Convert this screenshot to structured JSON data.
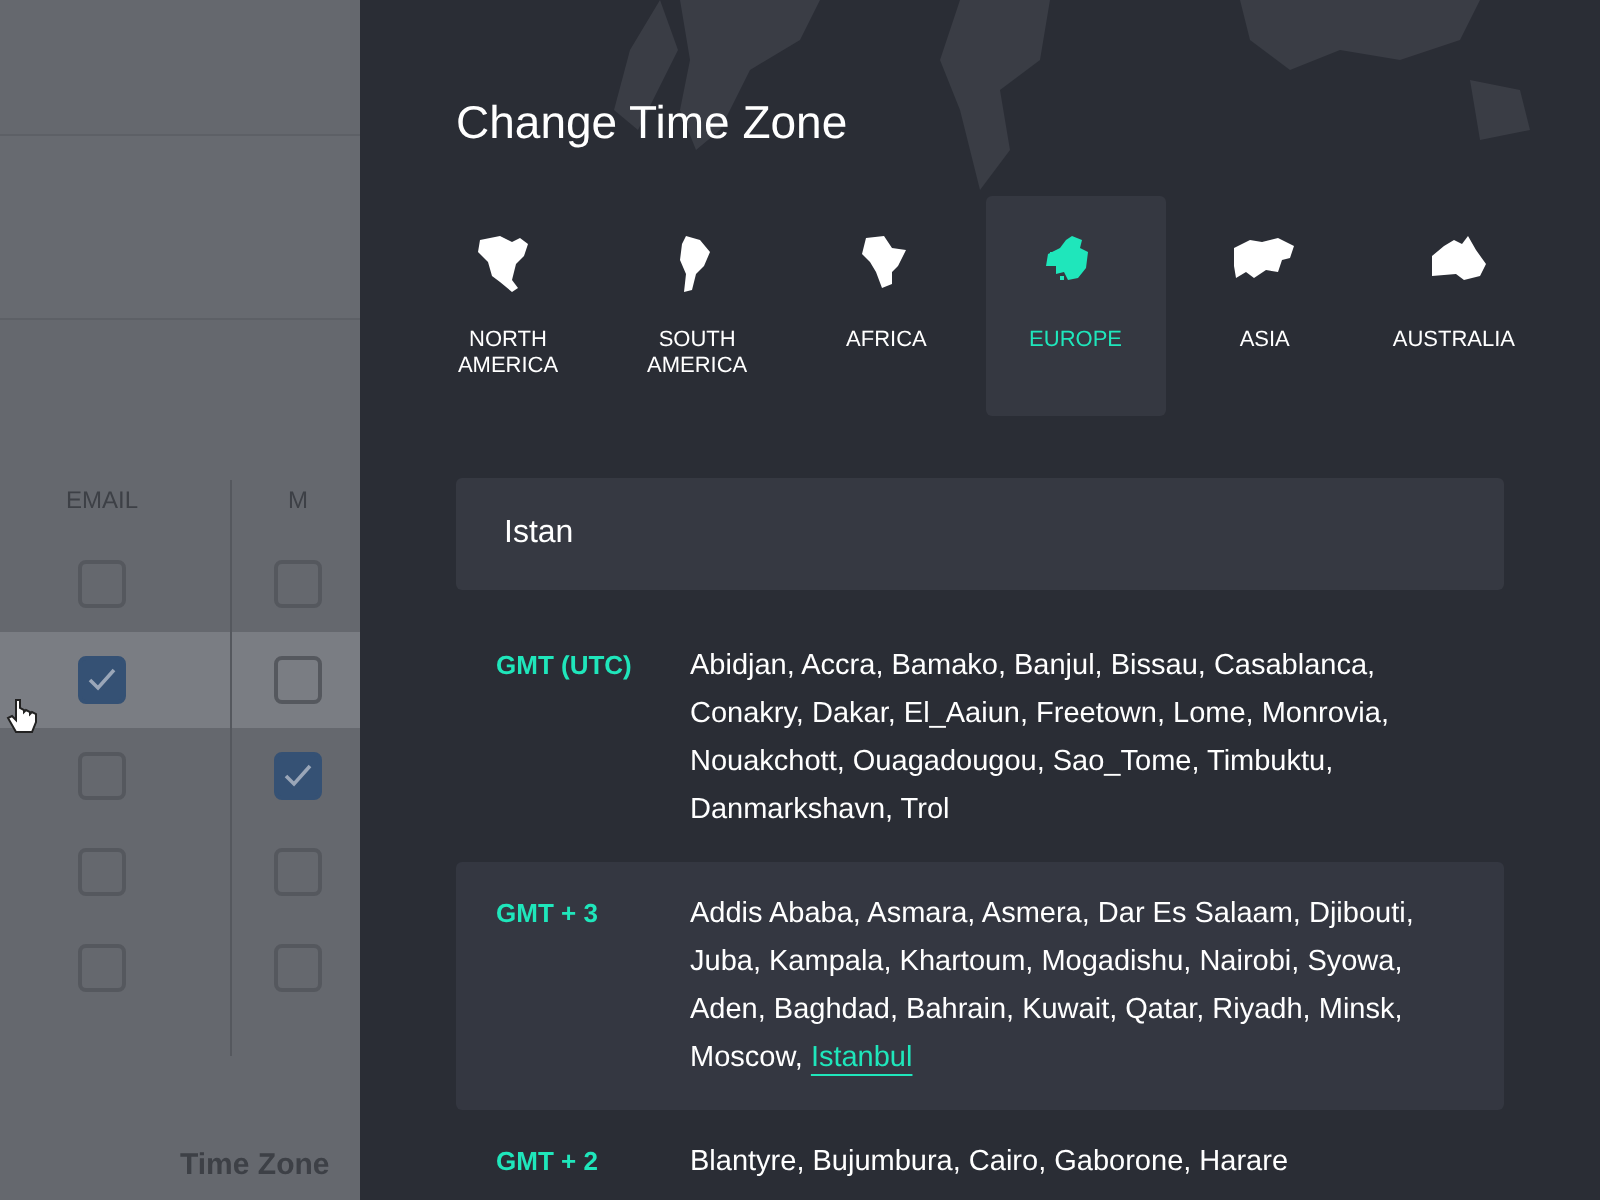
{
  "background": {
    "columns": [
      {
        "label": "EMAIL"
      },
      {
        "label": "M"
      }
    ],
    "rows": [
      {
        "hovered": false,
        "checks": [
          false,
          false
        ]
      },
      {
        "hovered": true,
        "checks": [
          true,
          false
        ]
      },
      {
        "hovered": false,
        "checks": [
          false,
          true
        ]
      },
      {
        "hovered": false,
        "checks": [
          false,
          false
        ]
      },
      {
        "hovered": false,
        "checks": [
          false,
          false
        ]
      }
    ],
    "footer_label": "Time Zone"
  },
  "panel": {
    "title": "Change Time Zone",
    "regions": [
      {
        "label": "NORTH AMERICA",
        "selected": false
      },
      {
        "label": "SOUTH AMERICA",
        "selected": false
      },
      {
        "label": "AFRICA",
        "selected": false
      },
      {
        "label": "EUROPE",
        "selected": true
      },
      {
        "label": "ASIA",
        "selected": false
      },
      {
        "label": "AUSTRALIA",
        "selected": false
      }
    ],
    "search": {
      "value": "Istan"
    },
    "results": [
      {
        "offset": "GMT (UTC)",
        "cities": "Abidjan, Accra, Bamako, Banjul, Bissau, Casablanca, Conakry, Dakar, El_Aaiun, Freetown, Lome, Monrovia, Nouakchott, Ouagadougou, Sao_Tome, Timbuktu, Danmarkshavn, Trol",
        "selected": false
      },
      {
        "offset": "GMT + 3",
        "cities": "Addis Ababa, Asmara, Asmera, Dar Es Salaam, Djibouti, Juba, Kampala, Khartoum, Mogadishu, Nairobi, Syowa, Aden, Baghdad, Bahrain, Kuwait, Qatar, Riyadh, Minsk, Moscow, ",
        "match": "Istanbul",
        "selected": true
      },
      {
        "offset": "GMT + 2",
        "cities": "Blantyre, Bujumbura, Cairo, Gaborone, Harare",
        "selected": false
      }
    ]
  }
}
